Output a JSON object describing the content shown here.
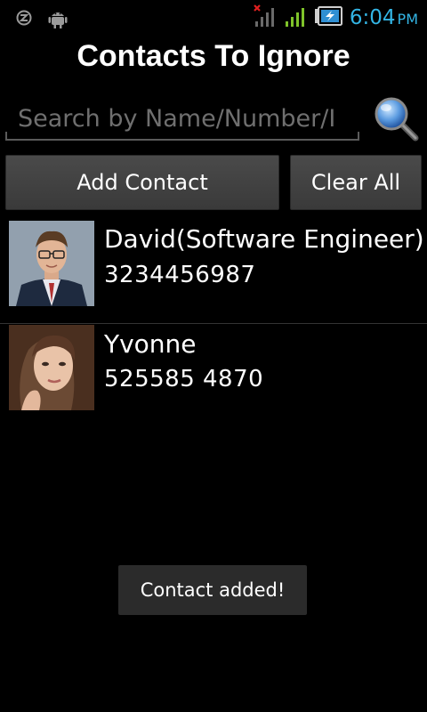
{
  "status_bar": {
    "icons": [
      "sync-icon",
      "android-debug-icon",
      "signal-no-service-icon",
      "signal-strength-icon",
      "battery-charging-icon"
    ],
    "time": "6:04",
    "ampm": "PM",
    "accent_color": "#33b5e5"
  },
  "header": {
    "title": "Contacts To Ignore"
  },
  "search": {
    "placeholder": "Search by Name/Number/I",
    "value": ""
  },
  "buttons": {
    "add_contact": "Add Contact",
    "clear_all": "Clear All"
  },
  "contacts": [
    {
      "name": "David(Software Engineer)",
      "number": "3234456987",
      "avatar": "avatar-photo-man"
    },
    {
      "name": "Yvonne",
      "number": "525585 4870",
      "avatar": "avatar-photo-woman"
    }
  ],
  "toast": {
    "message": "Contact added!"
  }
}
